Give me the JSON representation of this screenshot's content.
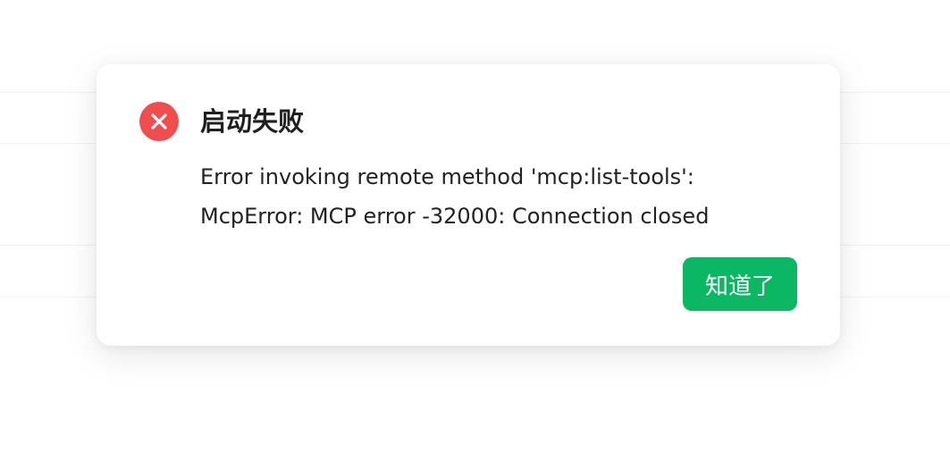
{
  "dialog": {
    "title": "启动失败",
    "message_lines": [
      "Error invoking remote method 'mcp:list-tools':",
      "McpError: MCP error -32000: Connection closed"
    ],
    "confirm_label": "知道了",
    "icon": "error-circle-x-icon"
  },
  "colors": {
    "error": "#f04e4e",
    "primary": "#0cb764"
  }
}
